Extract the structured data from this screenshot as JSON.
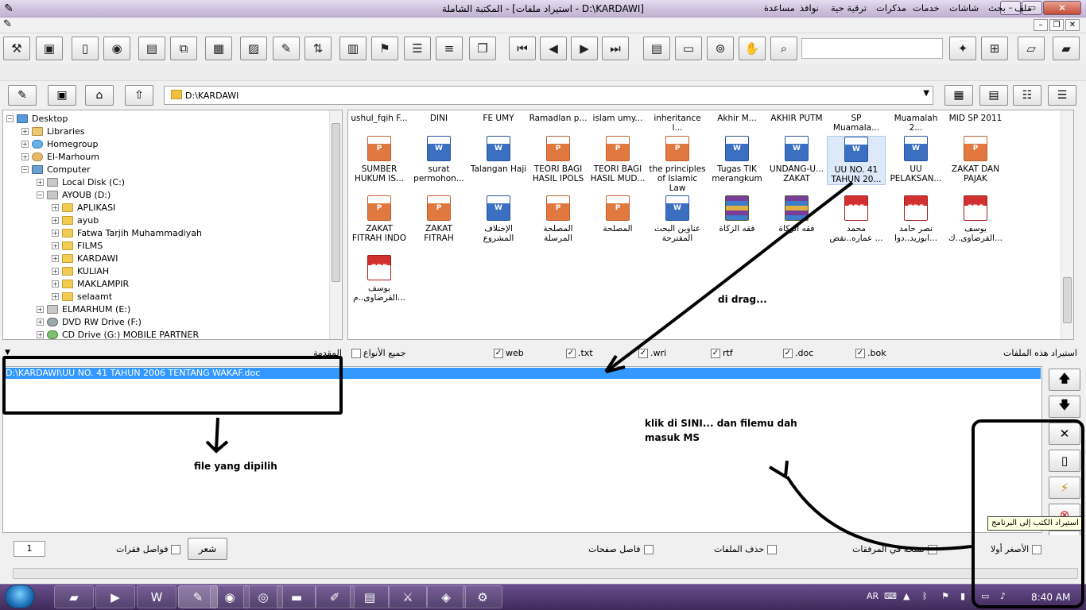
{
  "window": {
    "title": "المكتبة الشاملة - [استيراد ملفات - D:\\KARDAWI]",
    "min": "–",
    "max": "▭",
    "close": "✕"
  },
  "menu": [
    "ملف",
    "بحث",
    "شاشات",
    "خدمات",
    "مذكرات",
    "ترقية حية",
    "نوافذ",
    "مساعدة"
  ],
  "toolbar_search": {
    "value": ""
  },
  "path": "D:\\KARDAWI",
  "tree": [
    {
      "label": "Desktop",
      "icon": "desktop-icon",
      "level": 0,
      "exp": "−"
    },
    {
      "label": "Libraries",
      "icon": "library-icon",
      "level": 1,
      "exp": "+"
    },
    {
      "label": "Homegroup",
      "icon": "homegroup-icon",
      "level": 1,
      "exp": "+"
    },
    {
      "label": "El-Marhoum",
      "icon": "user-icon",
      "level": 1,
      "exp": "+"
    },
    {
      "label": "Computer",
      "icon": "computer-icon",
      "level": 1,
      "exp": "−"
    },
    {
      "label": "Local Disk (C:)",
      "icon": "drive-icon",
      "level": 2,
      "exp": "+"
    },
    {
      "label": "AYOUB (D:)",
      "icon": "drive-icon",
      "level": 2,
      "exp": "−"
    },
    {
      "label": "APLIKASI",
      "icon": "folder-icon",
      "level": 3,
      "exp": "+"
    },
    {
      "label": "ayub",
      "icon": "folder-icon",
      "level": 3,
      "exp": "+"
    },
    {
      "label": "Fatwa Tarjih Muhammadiyah",
      "icon": "folder-icon",
      "level": 3,
      "exp": "+"
    },
    {
      "label": "FILMS",
      "icon": "folder-icon",
      "level": 3,
      "exp": "+"
    },
    {
      "label": "KARDAWI",
      "icon": "folder-icon",
      "level": 3,
      "exp": "+"
    },
    {
      "label": "KULIAH",
      "icon": "folder-icon",
      "level": 3,
      "exp": "+"
    },
    {
      "label": "MAKLAMPIR",
      "icon": "folder-icon",
      "level": 3,
      "exp": "+"
    },
    {
      "label": "selaamt",
      "icon": "folder-icon",
      "level": 3,
      "exp": "+"
    },
    {
      "label": "ELMARHUM (E:)",
      "icon": "drive-icon",
      "level": 2,
      "exp": "+"
    },
    {
      "label": "DVD RW Drive (F:)",
      "icon": "dvd-icon",
      "level": 2,
      "exp": "+"
    },
    {
      "label": "CD Drive (G:) MOBILE PARTNER",
      "icon": "cd-icon",
      "level": 2,
      "exp": "+"
    }
  ],
  "files_top_row": [
    "ushul_fqih F...",
    "DINI",
    "FE UMY",
    "Ramadlan p...",
    "islam umy...",
    "inheritance l...",
    "Akhir M...",
    "AKHIR PUTM",
    "SP Muamala...",
    "Muamalah 2...",
    "MID SP 2011"
  ],
  "files": [
    {
      "name": "SUMBER HUKUM IS...",
      "type": "ppt"
    },
    {
      "name": "surat permohon...",
      "type": "doc"
    },
    {
      "name": "Talangan Haji",
      "type": "doc"
    },
    {
      "name": "TEORI BAGI HASIL IPOLS",
      "type": "ppt"
    },
    {
      "name": "TEORI BAGI HASIL MUD...",
      "type": "ppt"
    },
    {
      "name": "the principles of Islamic Law",
      "type": "ppt"
    },
    {
      "name": "Tugas TIK merangkum",
      "type": "doc"
    },
    {
      "name": "UNDANG-U... ZAKAT",
      "type": "doc"
    },
    {
      "name": "UU NO. 41 TAHUN 20...",
      "type": "doc",
      "selected": true
    },
    {
      "name": "UU PELAKSAN...",
      "type": "doc"
    },
    {
      "name": "ZAKAT DAN PAJAK",
      "type": "ppt"
    },
    {
      "name": "ZAKAT FITRAH INDO",
      "type": "ppt"
    },
    {
      "name": "ZAKAT FITRAH",
      "type": "ppt"
    },
    {
      "name": "الإختلاف المشروع",
      "type": "doc"
    },
    {
      "name": "المصلحة المرسلة",
      "type": "ppt"
    },
    {
      "name": "المصلحة",
      "type": "ppt"
    },
    {
      "name": "عناوين البحث المقترحة",
      "type": "doc"
    },
    {
      "name": "فقه الزكاة",
      "type": "rar"
    },
    {
      "name": "فقه الزكاة",
      "type": "rar"
    },
    {
      "name": "محمد عماره..نقض ...",
      "type": "pdf"
    },
    {
      "name": "نصر حامد ابوزيد..دوا...",
      "type": "pdf"
    },
    {
      "name": "يوسف القرضاوى..ك...",
      "type": "pdf"
    },
    {
      "name": "يوسف القرضاوى..م...",
      "type": "pdf"
    }
  ],
  "filters": {
    "import_label": "استيراد هذه الملفات",
    "all_types": "جميع الأنواع",
    "intro": "المقدمة",
    "types": [
      ".bok",
      ".doc",
      "rtf",
      ".wri",
      ".txt",
      "web"
    ]
  },
  "selected_file": "D:\\KARDAWI\\UU NO. 41 TAHUN 2006 TENTANG WAKAF.doc",
  "bottom": {
    "page": "1",
    "paragraph_sep": "فواصل فقرات",
    "poem": "شعر",
    "page_sep": "فاصل صفحات",
    "delete_files": "حذف الملفات",
    "attachments": "نسخة في المرفقات",
    "smallest_first": "الأصغر أولا"
  },
  "tooltip": "استيراد الكتب إلى البرنامج",
  "annotations": {
    "drag": "di drag...",
    "chosen": "file yang dipilih",
    "click_line1": "klik di SINI... dan filemu dah",
    "click_line2": "masuk MS"
  },
  "tray": {
    "lang": "AR",
    "time": "8:40 AM"
  }
}
